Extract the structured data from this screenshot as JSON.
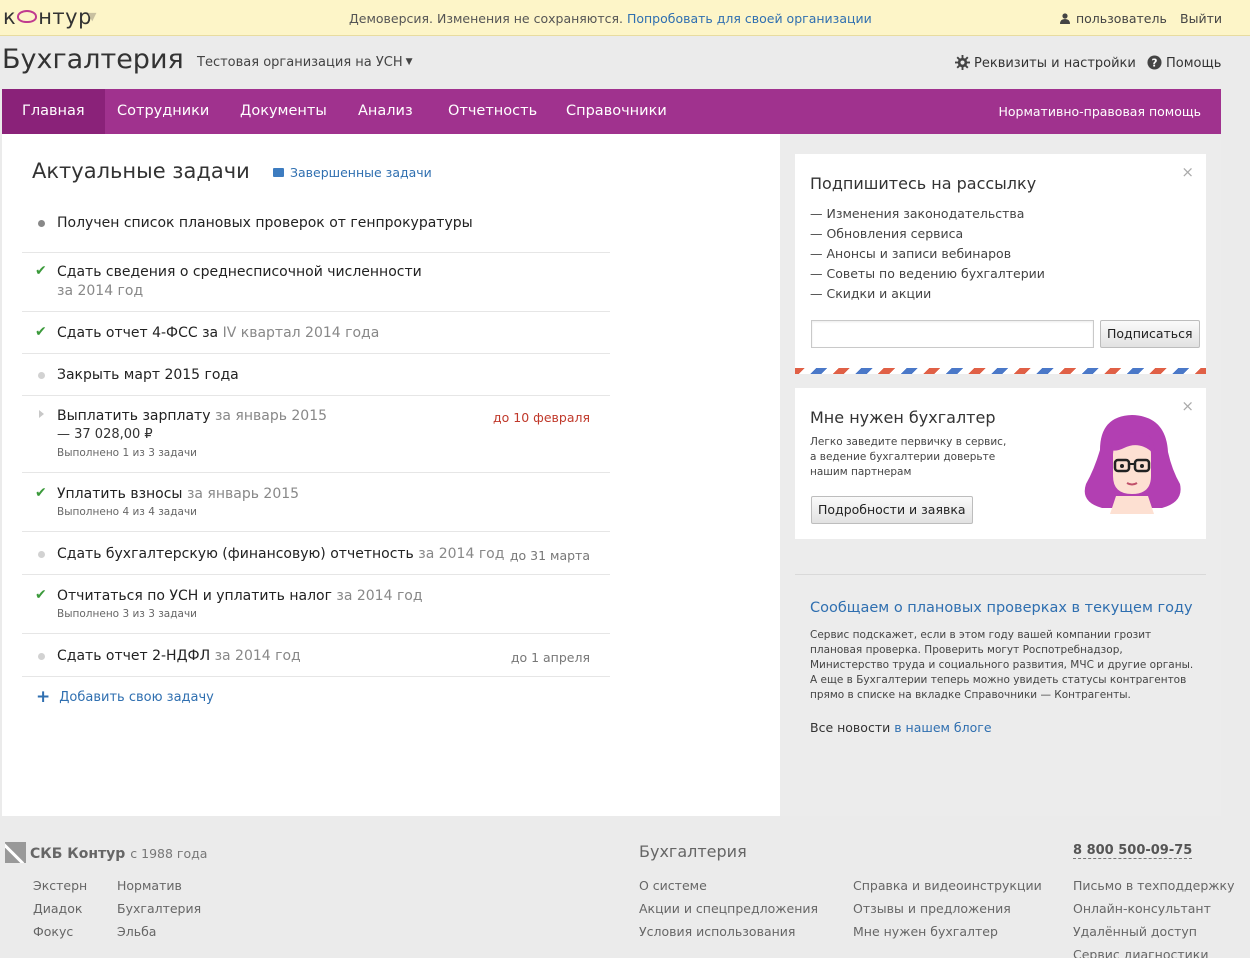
{
  "topbar": {
    "logo_text_start": "к",
    "logo_text_end": "нтур",
    "demo_notice": "Демоверсия. Изменения не сохраняются.",
    "demo_link": "Попробовать для своей организации",
    "user": "пользователь",
    "logout": "Выйти"
  },
  "header": {
    "title": "Бухгалтерия",
    "organization": "Тестовая организация на УСН",
    "settings": "Реквизиты и настройки",
    "help": "Помощь"
  },
  "nav": {
    "items": [
      "Главная",
      "Сотрудники",
      "Документы",
      "Анализ",
      "Отчетность",
      "Справочники"
    ],
    "active_index": 0,
    "right_link": "Нормативно-правовая помощь",
    "color": "#a0328e"
  },
  "tasks": {
    "title": "Актуальные задачи",
    "completed_link": "Завершенные задачи",
    "items": [
      {
        "status": "info",
        "title": "Получен список плановых проверок от генпрокуратуры"
      },
      {
        "status": "done",
        "title": "Сдать сведения о среднесписочной численности",
        "subtitle": "за 2014 год"
      },
      {
        "status": "done",
        "title": "Сдать отчет 4-ФСС за",
        "suffix": "IV квартал 2014 года"
      },
      {
        "status": "pending",
        "title": "Закрыть март 2015 года"
      },
      {
        "status": "expandable",
        "title": "Выплатить зарплату",
        "suffix": "за январь 2015",
        "amount": "— 37 028,00 ₽",
        "progress": "Выполнено 1 из 3 задачи",
        "due": "до 10 февраля"
      },
      {
        "status": "done",
        "title": "Уплатить взносы",
        "suffix": "за январь 2015",
        "progress": "Выполнено 4 из 4 задачи"
      },
      {
        "status": "pending",
        "title": "Сдать бухгалтерскую (финансовую) отчетность",
        "suffix": "за 2014 год",
        "due": "до 31 марта"
      },
      {
        "status": "done",
        "title": "Отчитаться по УСН и уплатить налог",
        "suffix": "за 2014 год",
        "progress": "Выполнено 3 из 3 задачи"
      },
      {
        "status": "pending",
        "title": "Сдать отчет 2-НДФЛ",
        "suffix": "за 2014 год",
        "due": "до 1 апреля"
      }
    ],
    "add_task": "Добавить свою задачу"
  },
  "subscribe": {
    "title": "Подпишитесь на рассылку",
    "topics": [
      "— Изменения законодательства",
      "— Обновления сервиса",
      "— Анонсы и записи вебинаров",
      "— Советы по ведению бухгалтерии",
      "— Скидки и акции"
    ],
    "email_value": "",
    "button": "Подписаться",
    "close": "×"
  },
  "accountant": {
    "title": "Мне нужен бухгалтер",
    "text": "Легко заведите первичку в сервис, а ведение бухгалтерии доверьте нашим партнерам",
    "button": "Подробности и заявка",
    "close": "×"
  },
  "news": {
    "title": "Сообщаем о плановых проверках в текущем году",
    "text": "Сервис подскажет, если в этом году вашей компании грозит плановая проверка. Проверить могут Роспотребнадзор, Министерство труда и социального развития, МЧС и другие органы. А еще в Бухгалтерии теперь можно увидеть статусы контрагентов прямо в списке на вкладке Справочники — Контрагенты.",
    "more_prefix": "Все новости",
    "more_link": "в нашем блоге"
  },
  "footer": {
    "company": "СКБ Контур",
    "since": "с 1988 года",
    "products_col1": [
      "Экстерн",
      "Диадок",
      "Фокус"
    ],
    "products_col2": [
      "Норматив",
      "Бухгалтерия",
      "Эльба"
    ],
    "section_title": "Бухгалтерия",
    "links_col1": [
      "О системе",
      "Акции и спецпредложения",
      "Условия использования"
    ],
    "links_col2": [
      "Справка и видеоинструкции",
      "Отзывы и предложения",
      "Мне нужен бухгалтер"
    ],
    "phone": "8 800 500-09-75",
    "support_links": [
      "Письмо в техподдержку",
      "Онлайн-консультант",
      "Удалённый доступ",
      "Сервис диагностики"
    ]
  }
}
